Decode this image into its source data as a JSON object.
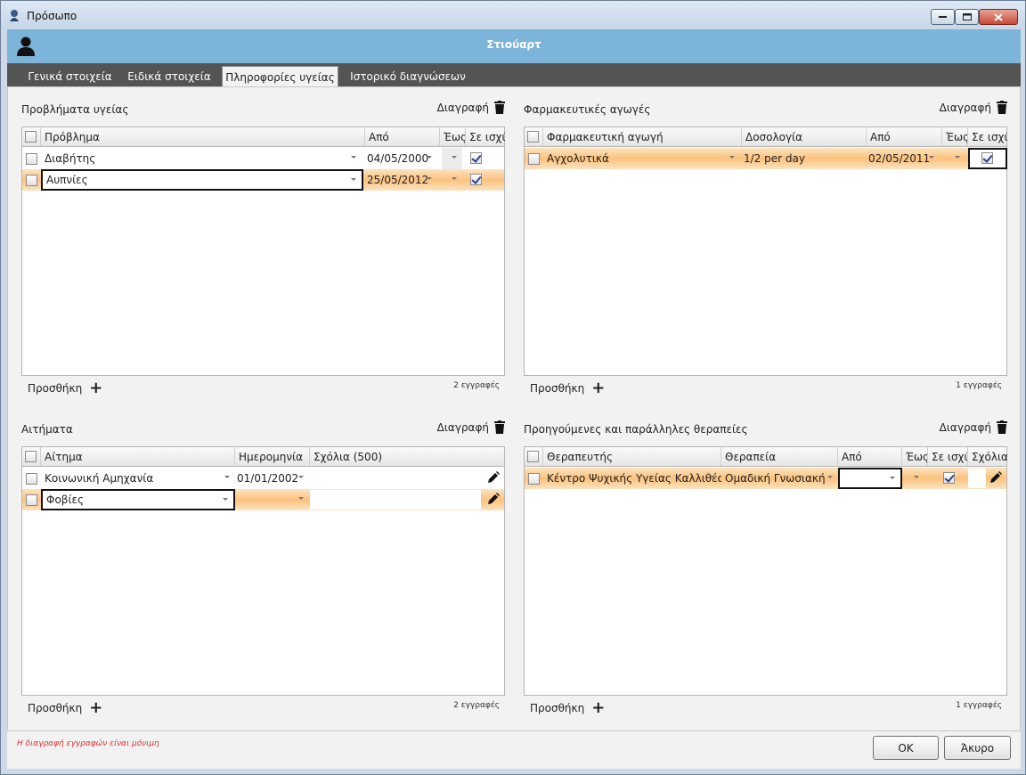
{
  "window": {
    "title": "Πρόσωπο"
  },
  "header": {
    "name": "Στιούαρτ"
  },
  "tabs": [
    {
      "label": "Γενικά στοιχεία"
    },
    {
      "label": "Ειδικά στοιχεία"
    },
    {
      "label": "Πληροφορίες υγείας",
      "active": true
    },
    {
      "label": "Ιστορικό διαγνώσεων"
    }
  ],
  "common": {
    "delete_label": "Διαγραφή",
    "add_label": "Προσθήκη",
    "plus": "+"
  },
  "health_problems": {
    "title": "Προβλήματα υγείας",
    "columns": [
      "Πρόβλημα",
      "Από",
      "Έως",
      "Σε ισχύ"
    ],
    "rows": [
      {
        "problem": "Διαβήτης",
        "from": "04/05/2000",
        "to": "",
        "active": true
      },
      {
        "problem": "Αυπνίες",
        "from": "25/05/2012",
        "to": "",
        "active": true
      }
    ],
    "count": "2 εγγραφές"
  },
  "medications": {
    "title": "Φαρμακευτικές αγωγές",
    "columns": [
      "Φαρμακευτική αγωγή",
      "Δοσολογία",
      "Από",
      "Έως",
      "Σε ισχύ"
    ],
    "rows": [
      {
        "medication": "Αγχολυτικά",
        "dosage": "1/2 per day",
        "from": "02/05/2011",
        "to": "",
        "active": true
      }
    ],
    "count": "1 εγγραφές"
  },
  "requests": {
    "title": "Αιτήματα",
    "columns": [
      "Αίτημα",
      "Ημερομηνία",
      "Σχόλια (500)"
    ],
    "rows": [
      {
        "request": "Κοινωνική Αμηχανία",
        "date": "01/01/2002",
        "comments": ""
      },
      {
        "request": "Φοβίες",
        "date": "",
        "comments": ""
      }
    ],
    "count": "2 εγγραφές"
  },
  "therapies": {
    "title": "Προηγούμενες και παράλληλες θεραπείες",
    "columns": [
      "Θεραπευτής",
      "Θεραπεία",
      "Από",
      "Έως",
      "Σε ισχύ",
      "Σχόλια"
    ],
    "rows": [
      {
        "therapist": "Κέντρο Ψυχικής Υγείας Καλλιθέα",
        "therapy": "Ομαδική Γνωσιακή",
        "from": "",
        "to": "",
        "active": true
      }
    ],
    "count": "1 εγγραφές"
  },
  "footer": {
    "note": "Η διαγραφή εγγραφών είναι μόνιμη",
    "ok_label": "OK",
    "cancel_label": "Άκυρο"
  }
}
